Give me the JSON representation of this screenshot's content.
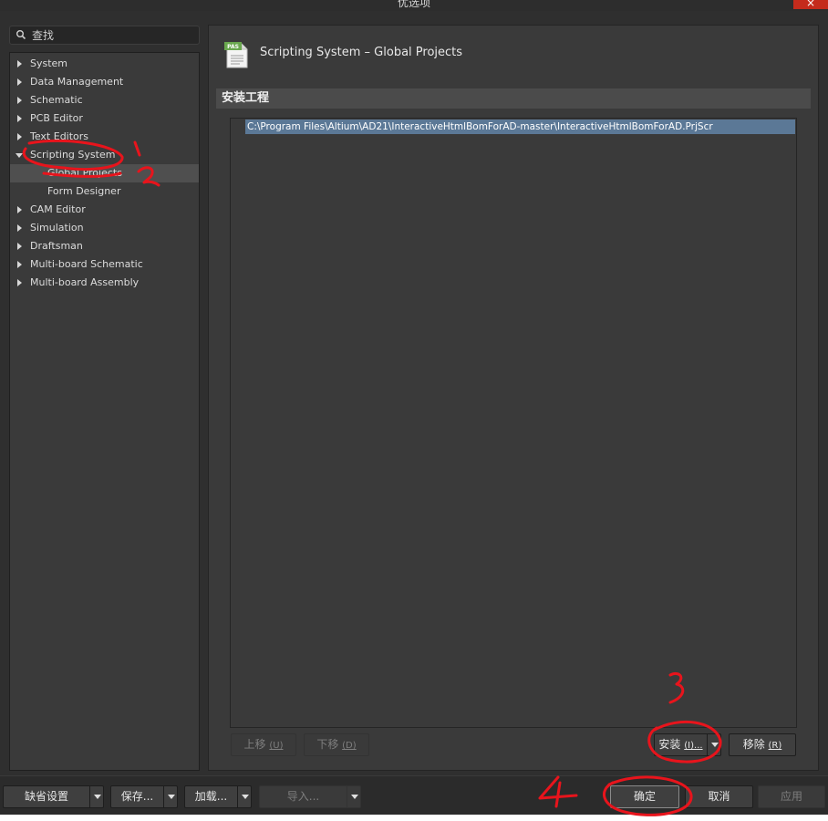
{
  "window": {
    "title": "优选项",
    "close_label": "×"
  },
  "search": {
    "placeholder": "查找"
  },
  "tree": [
    {
      "label": "System",
      "expanded": false
    },
    {
      "label": "Data Management",
      "expanded": false
    },
    {
      "label": "Schematic",
      "expanded": false
    },
    {
      "label": "PCB Editor",
      "expanded": false
    },
    {
      "label": "Text Editors",
      "expanded": false
    },
    {
      "label": "Scripting System",
      "expanded": true
    },
    {
      "label": "Global Projects",
      "child": true,
      "selected": true
    },
    {
      "label": "Form Designer",
      "child": true
    },
    {
      "label": "CAM Editor",
      "expanded": false
    },
    {
      "label": "Simulation",
      "expanded": false
    },
    {
      "label": "Draftsman",
      "expanded": false
    },
    {
      "label": "Multi-board Schematic",
      "expanded": false
    },
    {
      "label": "Multi-board Assembly",
      "expanded": false
    }
  ],
  "page": {
    "icon_text": "PAS",
    "title": "Scripting System – Global Projects",
    "section": "安装工程",
    "projects": [
      "C:\\Program Files\\Altium\\AD21\\InteractiveHtmlBomForAD-master\\InteractiveHtmlBomForAD.PrjScr"
    ],
    "move_up": "上移",
    "move_up_key": "(U)",
    "move_down": "下移",
    "move_down_key": "(D)",
    "install": "安装",
    "install_key": "(I)...",
    "remove": "移除",
    "remove_key": "(R)"
  },
  "footer": {
    "defaults": "缺省设置",
    "save": "保存...",
    "load": "加载...",
    "import": "导入...",
    "ok": "确定",
    "cancel": "取消",
    "apply": "应用"
  },
  "annotations": [
    "1",
    "2",
    "3",
    "4"
  ],
  "colors": {
    "annotation": "#e8141c",
    "selection": "#5b7896",
    "close": "#c42b1c"
  }
}
